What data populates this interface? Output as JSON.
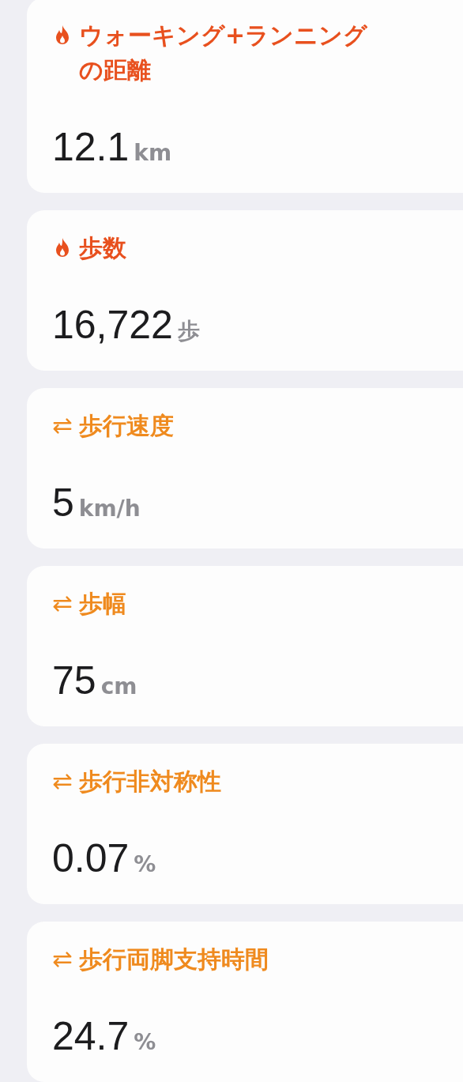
{
  "cards": [
    {
      "kind": "flame",
      "title": "ウォーキング+ランニングの距離",
      "value": "12.1",
      "unit": "km"
    },
    {
      "kind": "flame",
      "title": "歩数",
      "value": "16,722",
      "unit": "歩"
    },
    {
      "kind": "arrows",
      "title": "歩行速度",
      "value": "5",
      "unit": "km/h"
    },
    {
      "kind": "arrows",
      "title": "歩幅",
      "value": "75",
      "unit": "cm"
    },
    {
      "kind": "arrows",
      "title": "歩行非対称性",
      "value": "0.07",
      "unit": "%"
    },
    {
      "kind": "arrows",
      "title": "歩行両脚支持時間",
      "value": "24.7",
      "unit": "%"
    }
  ]
}
